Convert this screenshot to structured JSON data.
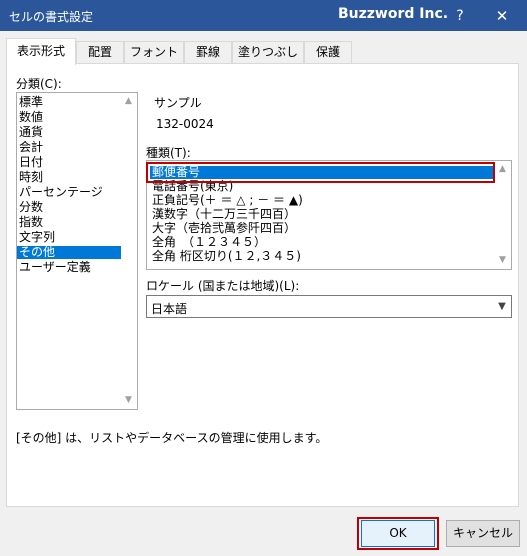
{
  "window": {
    "title": "セルの書式設定",
    "brand": "Buzzword Inc.",
    "help_glyph": "?",
    "close_glyph": "✕"
  },
  "tabs": [
    {
      "label": "表示形式",
      "active": true
    },
    {
      "label": "配置"
    },
    {
      "label": "フォント"
    },
    {
      "label": "罫線"
    },
    {
      "label": "塗りつぶし"
    },
    {
      "label": "保護"
    }
  ],
  "category": {
    "label": "分類(C):",
    "selected": "その他",
    "items": [
      "標準",
      "数値",
      "通貨",
      "会計",
      "日付",
      "時刻",
      "パーセンテージ",
      "分数",
      "指数",
      "文字列",
      "その他",
      "ユーザー定義"
    ]
  },
  "sample": {
    "label": "サンプル",
    "value": "132-0024"
  },
  "type": {
    "label": "種類(T):",
    "selected": "郵便番号",
    "items": [
      "郵便番号",
      "電話番号(東京)",
      "正負記号(＋ ＝ △ ; － ＝ ▲)",
      "漢数字（十二万三千四百）",
      "大字（壱拾弐萬参阡四百）",
      "全角　（１２３４５）",
      "全角 桁区切り(１２,３４５)"
    ]
  },
  "locale": {
    "label": "ロケール (国または地域)(L):",
    "value": "日本語"
  },
  "description": "[その他] は、リストやデータベースの管理に使用します。",
  "buttons": {
    "ok": "OK",
    "cancel": "キャンセル"
  },
  "icons": {
    "scroll_up": "▲",
    "scroll_down": "▼",
    "combo_arrow": "▼"
  },
  "colors": {
    "titlebar": "#2b579a",
    "selection": "#0078d7",
    "highlight_frame": "#c00000"
  }
}
